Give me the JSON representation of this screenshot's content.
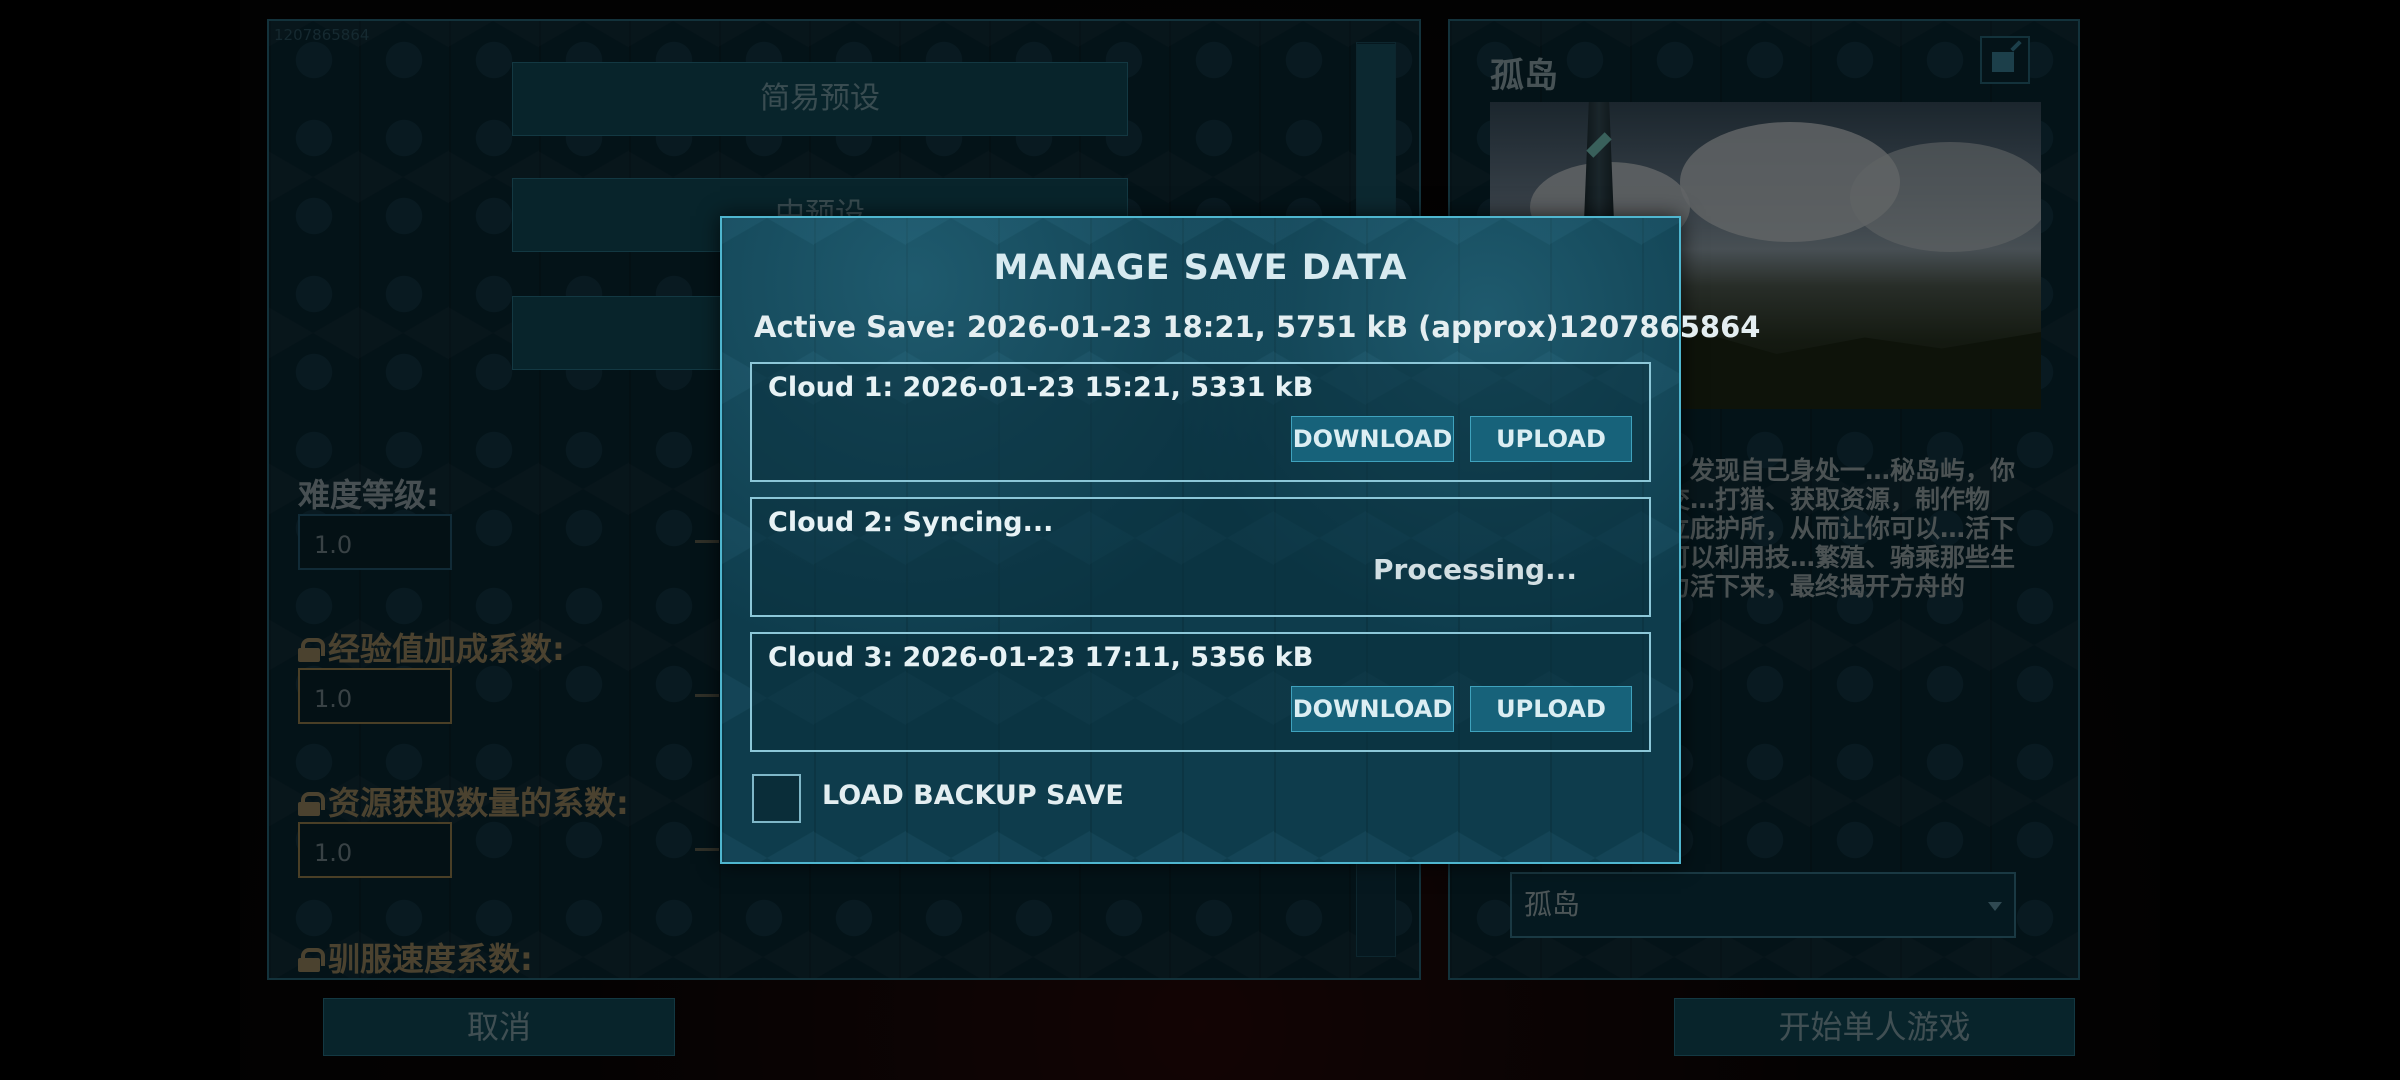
{
  "background": {
    "corner_id": "1207865864",
    "presets": [
      "简易预设",
      "中预设"
    ],
    "settings": [
      {
        "label": "难度等级:",
        "value": "1.0",
        "locked": false
      },
      {
        "label": "经验值加成系数:",
        "value": "1.0",
        "locked": true
      },
      {
        "label": "资源获取数量的系数:",
        "value": "1.0",
        "locked": true
      },
      {
        "label": "驯服速度系数:",
        "value": "",
        "locked": true
      }
    ],
    "cancel_label": "取消",
    "start_label": "开始单人游戏"
  },
  "map_panel": {
    "title": "孤岛",
    "description": "…空旷的海岸边，发现自己身处一…秘岛屿，你身无寸缕，饥寒交…打猎、获取资源，制作物品，种…技，建立庇护所，从而让你可以…活下去。同时，你也可以利用技…繁殖、骑乘那些生活在这片岛…努力活下来，最终揭开方舟的",
    "selected_map": "孤岛"
  },
  "modal": {
    "title": "MANAGE SAVE DATA",
    "active_save": "Active Save: 2026-01-23 18:21, 5751 kB (approx)1207865864",
    "slots": [
      {
        "label": "Cloud 1: 2026-01-23 15:21, 5331 kB",
        "download": "DOWNLOAD",
        "upload": "UPLOAD"
      },
      {
        "label": "Cloud 2: Syncing...",
        "status": "Processing..."
      },
      {
        "label": "Cloud 3: 2026-01-23 17:11, 5356 kB",
        "download": "DOWNLOAD",
        "upload": "UPLOAD"
      }
    ],
    "backup_label": "LOAD BACKUP SAVE",
    "backup_checked": false
  }
}
